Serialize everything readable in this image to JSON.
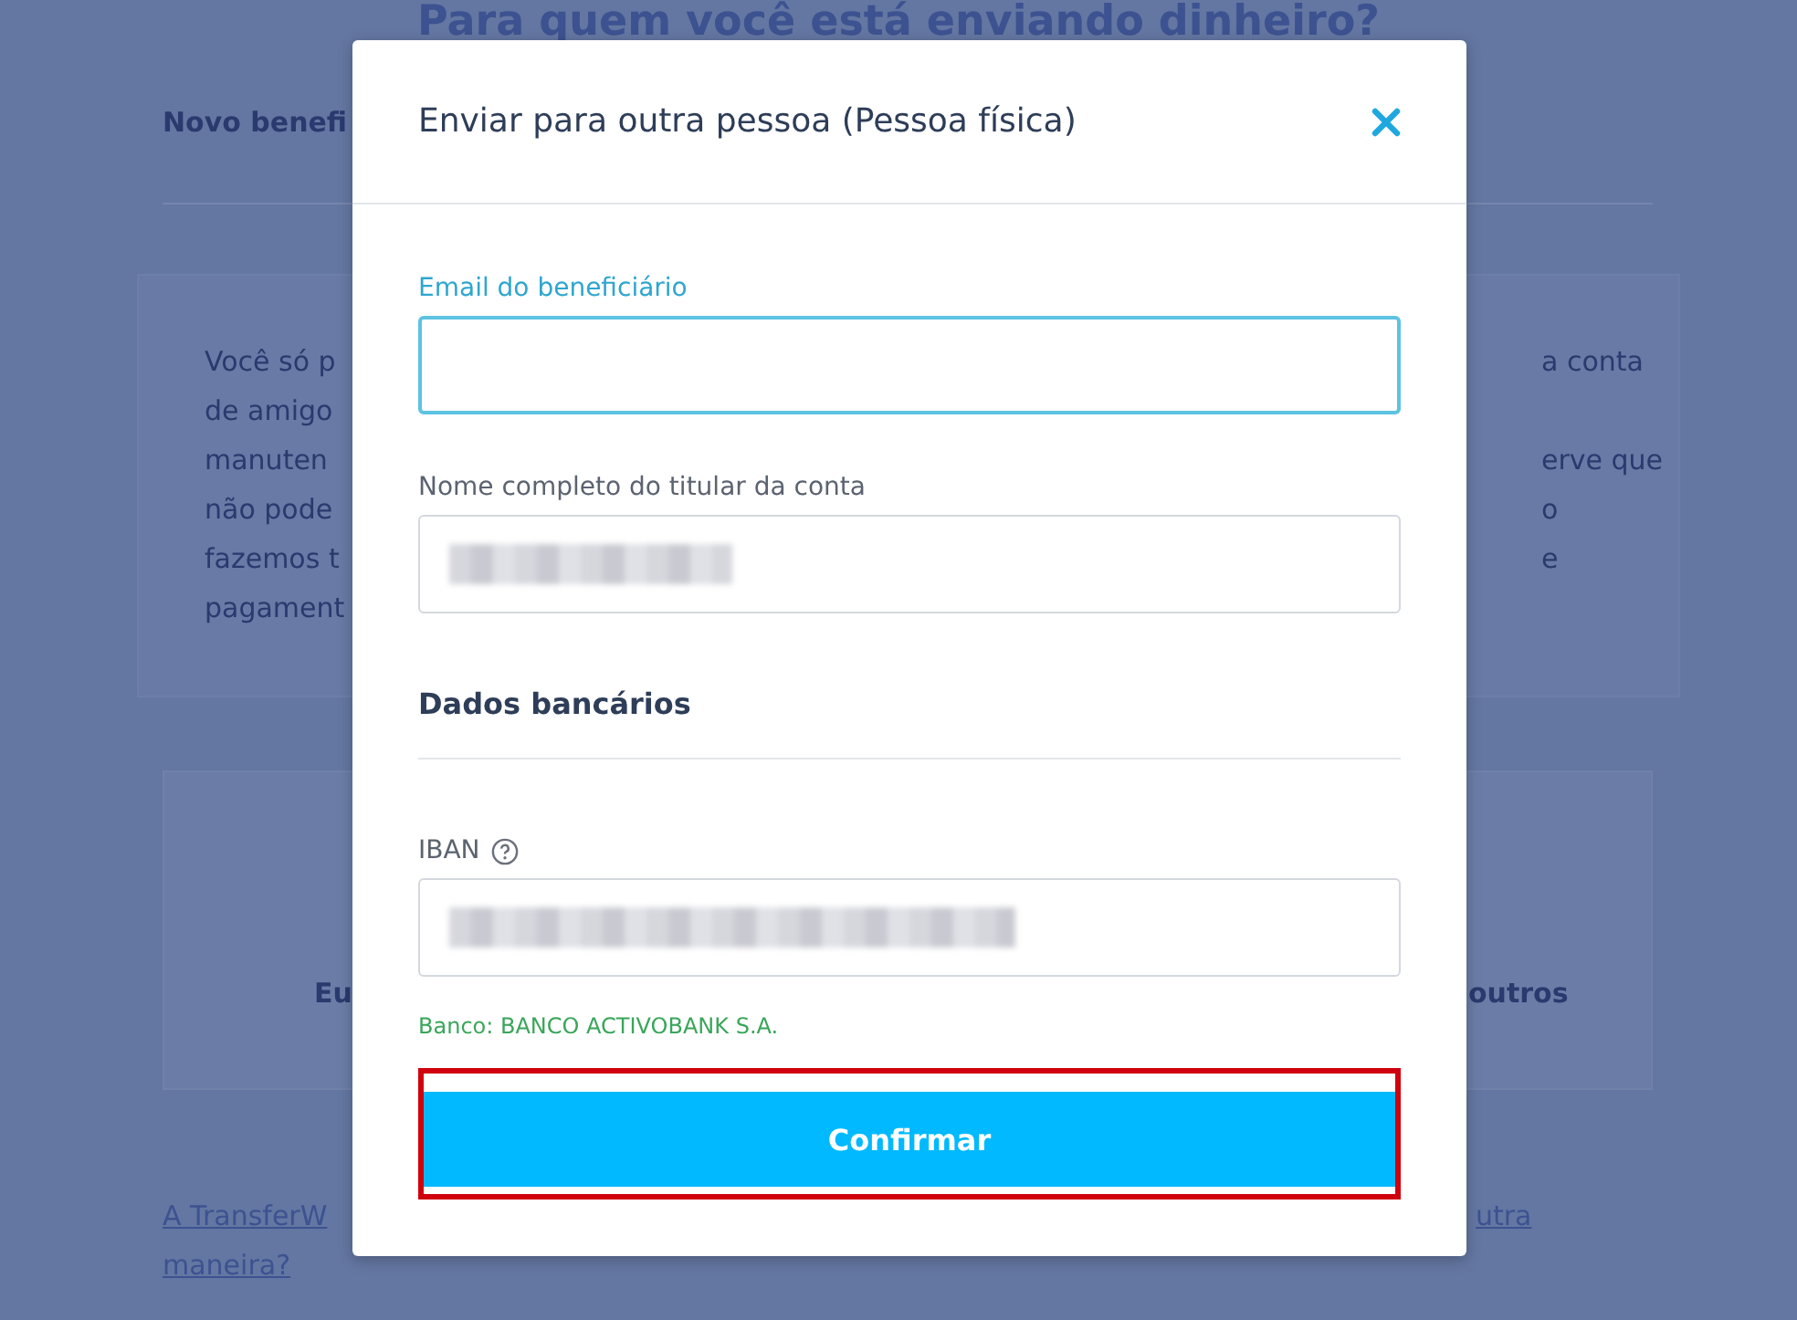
{
  "background": {
    "heading": "Para quem você está enviando dinheiro?",
    "tab_label": "Novo benefi",
    "info_rows": [
      {
        "left": "Você só p",
        "right": "a conta"
      },
      {
        "left": "de amigo"
      },
      {
        "left": "manuten",
        "right": "erve que"
      },
      {
        "left": "não pode",
        "right": "o"
      },
      {
        "left": "fazemos t",
        "right": "e"
      },
      {
        "left": "pagament"
      }
    ],
    "card": {
      "left": "Eu",
      "right": "outros"
    },
    "links": [
      {
        "left": "A TransferW",
        "right": "utra"
      },
      {
        "left": "maneira?"
      }
    ]
  },
  "modal": {
    "title": "Enviar para outra pessoa (Pessoa física)",
    "fields": [
      {
        "label": "Email do beneficiário",
        "focused": true,
        "redacted": false
      },
      {
        "label": "Nome completo do titular da conta",
        "focused": false,
        "redacted": true
      }
    ],
    "section_title": "Dados bancários",
    "iban": {
      "label": "IBAN",
      "focused": false,
      "redacted": true
    },
    "bank_note": "Banco: BANCO ACTIVOBANK S.A.",
    "confirm_button": {
      "label": "Confirmar",
      "highlighted": true
    }
  }
}
